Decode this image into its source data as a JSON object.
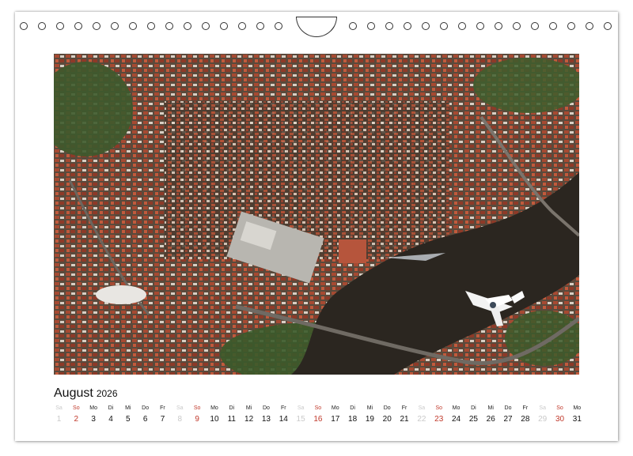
{
  "calendar": {
    "month": "August",
    "year": "2026",
    "days": [
      {
        "wd": "Sa",
        "d": "1",
        "type": "sat"
      },
      {
        "wd": "So",
        "d": "2",
        "type": "sun"
      },
      {
        "wd": "Mo",
        "d": "3",
        "type": "week"
      },
      {
        "wd": "Di",
        "d": "4",
        "type": "week"
      },
      {
        "wd": "Mi",
        "d": "5",
        "type": "week"
      },
      {
        "wd": "Do",
        "d": "6",
        "type": "week"
      },
      {
        "wd": "Fr",
        "d": "7",
        "type": "week"
      },
      {
        "wd": "Sa",
        "d": "8",
        "type": "sat"
      },
      {
        "wd": "So",
        "d": "9",
        "type": "sun"
      },
      {
        "wd": "Mo",
        "d": "10",
        "type": "week"
      },
      {
        "wd": "Di",
        "d": "11",
        "type": "week"
      },
      {
        "wd": "Mi",
        "d": "12",
        "type": "week"
      },
      {
        "wd": "Do",
        "d": "13",
        "type": "week"
      },
      {
        "wd": "Fr",
        "d": "14",
        "type": "week"
      },
      {
        "wd": "Sa",
        "d": "15",
        "type": "sat"
      },
      {
        "wd": "So",
        "d": "16",
        "type": "sun"
      },
      {
        "wd": "Mo",
        "d": "17",
        "type": "week"
      },
      {
        "wd": "Di",
        "d": "18",
        "type": "week"
      },
      {
        "wd": "Mi",
        "d": "19",
        "type": "week"
      },
      {
        "wd": "Do",
        "d": "20",
        "type": "week"
      },
      {
        "wd": "Fr",
        "d": "21",
        "type": "week"
      },
      {
        "wd": "Sa",
        "d": "22",
        "type": "sat"
      },
      {
        "wd": "So",
        "d": "23",
        "type": "sun"
      },
      {
        "wd": "Mo",
        "d": "24",
        "type": "week"
      },
      {
        "wd": "Di",
        "d": "25",
        "type": "week"
      },
      {
        "wd": "Mi",
        "d": "26",
        "type": "week"
      },
      {
        "wd": "Do",
        "d": "27",
        "type": "week"
      },
      {
        "wd": "Fr",
        "d": "28",
        "type": "week"
      },
      {
        "wd": "Sa",
        "d": "29",
        "type": "sat"
      },
      {
        "wd": "So",
        "d": "30",
        "type": "sun"
      },
      {
        "wd": "Mo",
        "d": "31",
        "type": "week"
      }
    ]
  },
  "colors": {
    "sunday": "#c0392b",
    "saturday": "#c9c9c9",
    "weekday": "#111111"
  },
  "photo": {
    "icon": "aerial-city-photo"
  }
}
